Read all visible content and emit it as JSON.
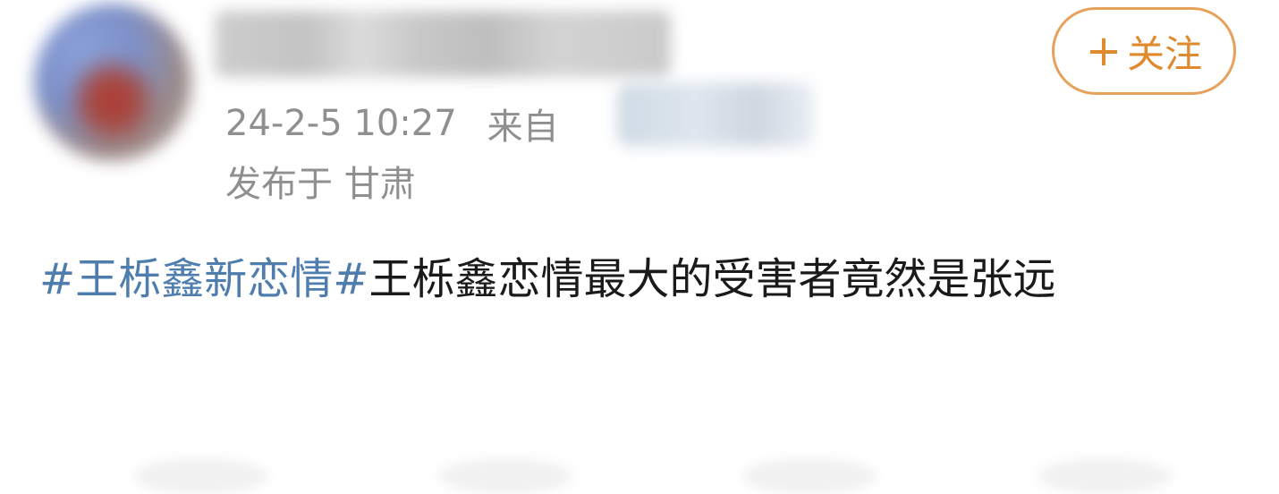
{
  "post": {
    "timestamp": "24-2-5 10:27",
    "source_prefix": "来自",
    "location": "发布于 甘肃",
    "follow_button": {
      "plus": "+",
      "label": "关注",
      "color": "#e08a2e"
    },
    "hashtag": "#王栎鑫新恋情#",
    "text": "王栎鑫恋情最大的受害者竟然是张远",
    "hashtag_color": "#4f7eae"
  }
}
